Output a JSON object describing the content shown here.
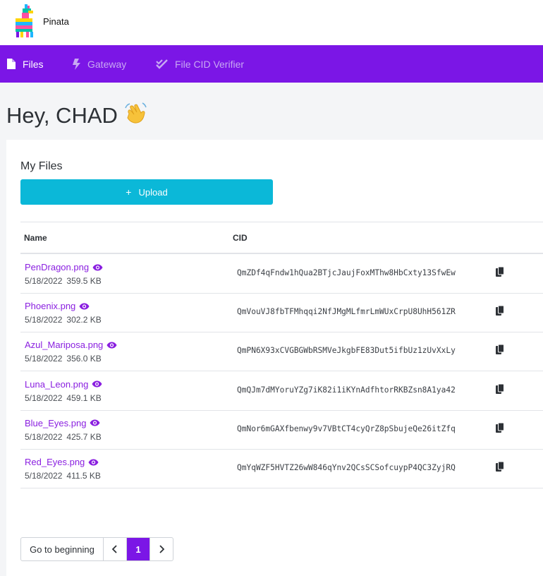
{
  "app": {
    "name": "Pinata"
  },
  "nav": {
    "items": [
      {
        "label": "Files",
        "icon": "file-icon",
        "active": true
      },
      {
        "label": "Gateway",
        "icon": "bolt-icon",
        "active": false
      },
      {
        "label": "File CID Verifier",
        "icon": "double-check-icon",
        "active": false
      }
    ]
  },
  "greeting": {
    "text": "Hey, CHAD",
    "emoji": "👋"
  },
  "files": {
    "title": "My Files",
    "upload_label": "Upload",
    "columns": {
      "name": "Name",
      "cid": "CID"
    },
    "rows": [
      {
        "name": "PenDragon.png",
        "date": "5/18/2022",
        "size": "359.5 KB",
        "cid": "QmZDf4qFndw1hQua2BTjcJaujFoxMThw8HbCxty13SfwEw"
      },
      {
        "name": "Phoenix.png",
        "date": "5/18/2022",
        "size": "302.2 KB",
        "cid": "QmVouVJ8fbTFMhqqi2NfJMgMLfmrLmWUxCrpU8UhH561ZR"
      },
      {
        "name": "Azul_Mariposa.png",
        "date": "5/18/2022",
        "size": "356.0 KB",
        "cid": "QmPN6X93xCVGBGWbRSMVeJkgbFE83Dut5ifbUz1zUvXxLy"
      },
      {
        "name": "Luna_Leon.png",
        "date": "5/18/2022",
        "size": "459.1 KB",
        "cid": "QmQJm7dMYoruYZg7iK82i1iKYnAdfhtorRKBZsn8A1ya42"
      },
      {
        "name": "Blue_Eyes.png",
        "date": "5/18/2022",
        "size": "425.7 KB",
        "cid": "QmNor6mGAXfbenwy9v7VBtCT4cyQrZ8pSbujeQe26itZfq"
      },
      {
        "name": "Red_Eyes.png",
        "date": "5/18/2022",
        "size": "411.5 KB",
        "cid": "QmYqWZF5HVTZ26wW846qYnv2QCsSCSofcuypP4QC3ZyjRQ"
      }
    ]
  },
  "pagination": {
    "begin_label": "Go to beginning",
    "current_page": "1"
  },
  "colors": {
    "primary": "#7b16e6",
    "accent": "#0bb8d8",
    "link": "#8a1fe0"
  }
}
